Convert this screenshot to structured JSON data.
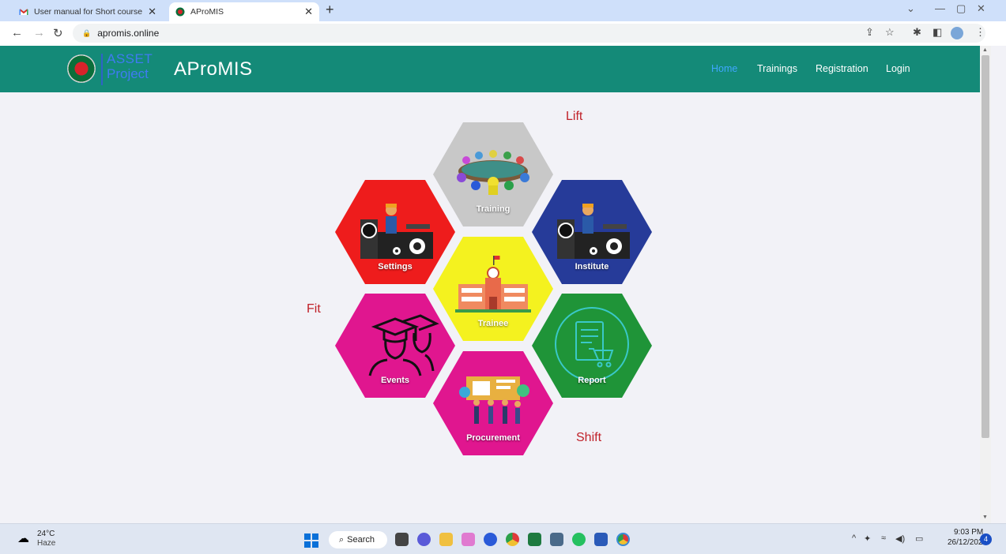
{
  "browser": {
    "tabs": [
      {
        "title": "User manual for Short course Eli",
        "favicon": "gmail-icon",
        "active": false
      },
      {
        "title": "AProMIS",
        "favicon": "apromis-icon",
        "active": true
      }
    ],
    "url": "apromis.online"
  },
  "site": {
    "logo_line1": "ASSET",
    "logo_line2": "Project",
    "title": "AProMIS",
    "nav": [
      {
        "label": "Home",
        "active": true
      },
      {
        "label": "Trainings",
        "active": false
      },
      {
        "label": "Registration",
        "active": false
      },
      {
        "label": "Login",
        "active": false
      }
    ]
  },
  "hexes": [
    {
      "label": "Training",
      "color": "#c8c8c8",
      "icon": "meeting-table-icon"
    },
    {
      "label": "Settings",
      "color": "#ee1c1c",
      "icon": "worker-machine-icon"
    },
    {
      "label": "Institute",
      "color": "#263b99",
      "icon": "worker-machine-icon"
    },
    {
      "label": "Trainee",
      "color": "#f4f21f",
      "icon": "school-building-icon"
    },
    {
      "label": "Events",
      "color": "#e0168f",
      "icon": "graduates-icon"
    },
    {
      "label": "Report",
      "color": "#1f9438",
      "icon": "report-cart-icon"
    },
    {
      "label": "Procurement",
      "color": "#e0168f",
      "icon": "team-board-icon"
    }
  ],
  "words": {
    "lift": "Lift",
    "fit": "Fit",
    "shift": "Shift"
  },
  "taskbar": {
    "temp": "24°C",
    "weather": "Haze",
    "search": "Search",
    "time": "9:03 PM",
    "date": "26/12/2022",
    "notifications": "4"
  }
}
